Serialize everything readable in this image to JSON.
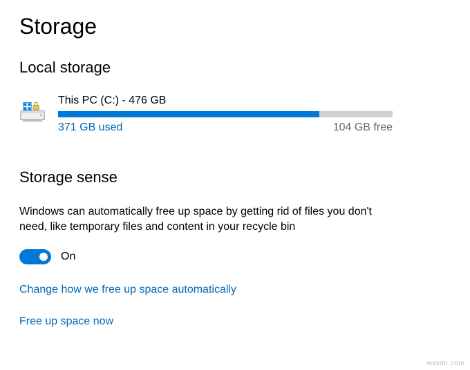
{
  "page": {
    "title": "Storage"
  },
  "localStorage": {
    "heading": "Local storage",
    "disk": {
      "label": "This PC (C:) - 476 GB",
      "usedText": "371 GB used",
      "freeText": "104 GB free",
      "usedPercent": 78
    }
  },
  "storageSense": {
    "heading": "Storage sense",
    "description": "Windows can automatically free up space by getting rid of files you don't need, like temporary files and content in your recycle bin",
    "toggleState": "On",
    "linkChange": "Change how we free up space automatically",
    "linkFreeNow": "Free up space now"
  },
  "watermark": "wsxdn.com"
}
